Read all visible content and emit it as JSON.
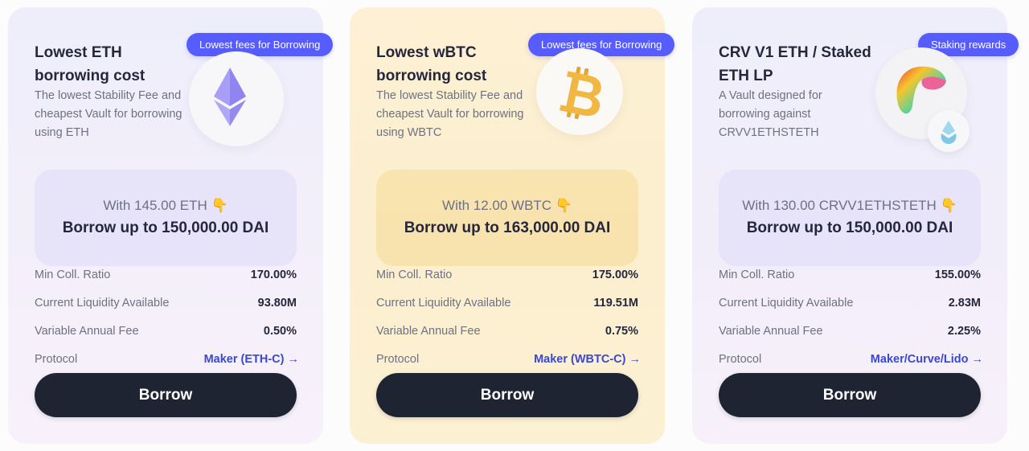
{
  "cards": [
    {
      "badge": "Lowest fees for Borrowing",
      "title": "Lowest ETH borrowing cost",
      "description": "The lowest Stability Fee and cheapest Vault for borrowing using ETH",
      "icon": "eth-icon",
      "with_text": "With 145.00 ETH 👇",
      "borrow_text": "Borrow up to 150,000.00 DAI",
      "stats": [
        {
          "label": "Min Coll. Ratio",
          "value": "170.00%"
        },
        {
          "label": "Current Liquidity Available",
          "value": "93.80M"
        },
        {
          "label": "Variable Annual Fee",
          "value": "0.50%"
        }
      ],
      "protocol_label": "Protocol",
      "protocol_link": "Maker (ETH-C) →",
      "button": "Borrow"
    },
    {
      "badge": "Lowest fees for Borrowing",
      "title": "Lowest wBTC borrowing cost",
      "description": "The lowest Stability Fee and cheapest Vault for borrowing using WBTC",
      "icon": "bitcoin-icon",
      "with_text": "With 12.00 WBTC 👇",
      "borrow_text": "Borrow up to 163,000.00 DAI",
      "stats": [
        {
          "label": "Min Coll. Ratio",
          "value": "175.00%"
        },
        {
          "label": "Current Liquidity Available",
          "value": "119.51M"
        },
        {
          "label": "Variable Annual Fee",
          "value": "0.75%"
        }
      ],
      "protocol_label": "Protocol",
      "protocol_link": "Maker (WBTC-C) →",
      "button": "Borrow"
    },
    {
      "badge": "Staking rewards",
      "title": "CRV V1 ETH / Staked ETH LP",
      "description": "A Vault designed for borrowing against CRVV1ETHSTETH",
      "icon": "curve-icon",
      "icon2": "lido-icon",
      "with_text": "With 130.00 CRVV1ETHSTETH 👇",
      "borrow_text": "Borrow up to 150,000.00 DAI",
      "stats": [
        {
          "label": "Min Coll. Ratio",
          "value": "155.00%"
        },
        {
          "label": "Current Liquidity Available",
          "value": "2.83M"
        },
        {
          "label": "Variable Annual Fee",
          "value": "2.25%"
        }
      ],
      "protocol_label": "Protocol",
      "protocol_link": "Maker/Curve/Lido →",
      "button": "Borrow"
    }
  ],
  "colors": {
    "badge": "#575cfe",
    "button": "#1f2433",
    "link": "#3a47d4",
    "eth_purple": "#8f84f0",
    "btc_gold": "#eeb33f"
  }
}
